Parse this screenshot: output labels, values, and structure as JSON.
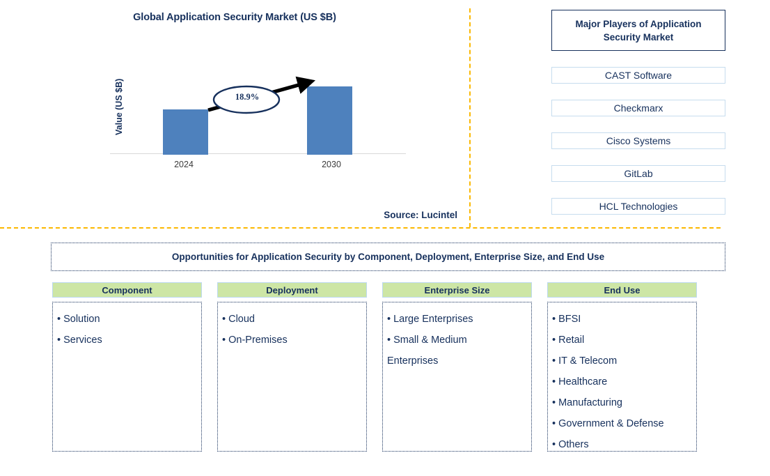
{
  "chart_panel": {
    "title": "Global Application Security Market (US $B)",
    "y_axis_label": "Value (US $B)",
    "cagr_label": "18.9%",
    "source": "Source: Lucintel"
  },
  "chart_data": {
    "type": "bar",
    "title": "Global Application Security Market (US $B)",
    "categories": [
      "2024",
      "2030"
    ],
    "values": [
      65,
      98
    ],
    "value_unit": "relative bar height (px) — absolute values not labeled",
    "xlabel": "",
    "ylabel": "Value (US $B)",
    "annotations": [
      {
        "text": "18.9%",
        "meaning": "CAGR arrow from 2024 bar to 2030 bar"
      }
    ],
    "grid": false,
    "legend": "none",
    "bar_color": "#4E81BD",
    "axis_color": "#d9d9d9"
  },
  "players": {
    "header": "Major Players of Application Security Market",
    "items": [
      {
        "label": "CAST Software"
      },
      {
        "label": "Checkmarx"
      },
      {
        "label": "Cisco Systems"
      },
      {
        "label": "GitLab"
      },
      {
        "label": "HCL Technologies"
      }
    ]
  },
  "opportunities": {
    "banner": "Opportunities for Application Security by Component, Deployment, Enterprise Size, and End Use",
    "columns": [
      {
        "header": "Component",
        "items": [
          "• Solution",
          "• Services"
        ]
      },
      {
        "header": "Deployment",
        "items": [
          "• Cloud",
          "• On-Premises"
        ]
      },
      {
        "header": "Enterprise Size",
        "items": [
          "• Large Enterprises",
          "• Small & Medium\n   Enterprises"
        ]
      },
      {
        "header": "End Use",
        "items": [
          "• BFSI",
          "• Retail",
          "• IT & Telecom",
          "• Healthcare",
          "• Manufacturing",
          "• Government & Defense",
          "• Others"
        ]
      }
    ]
  },
  "colors": {
    "navy": "#16305c",
    "bar_blue": "#4E81BD",
    "header_green": "#CDE6A5",
    "divider_orange": "#FBB800",
    "player_border": "#C6DCEE"
  }
}
